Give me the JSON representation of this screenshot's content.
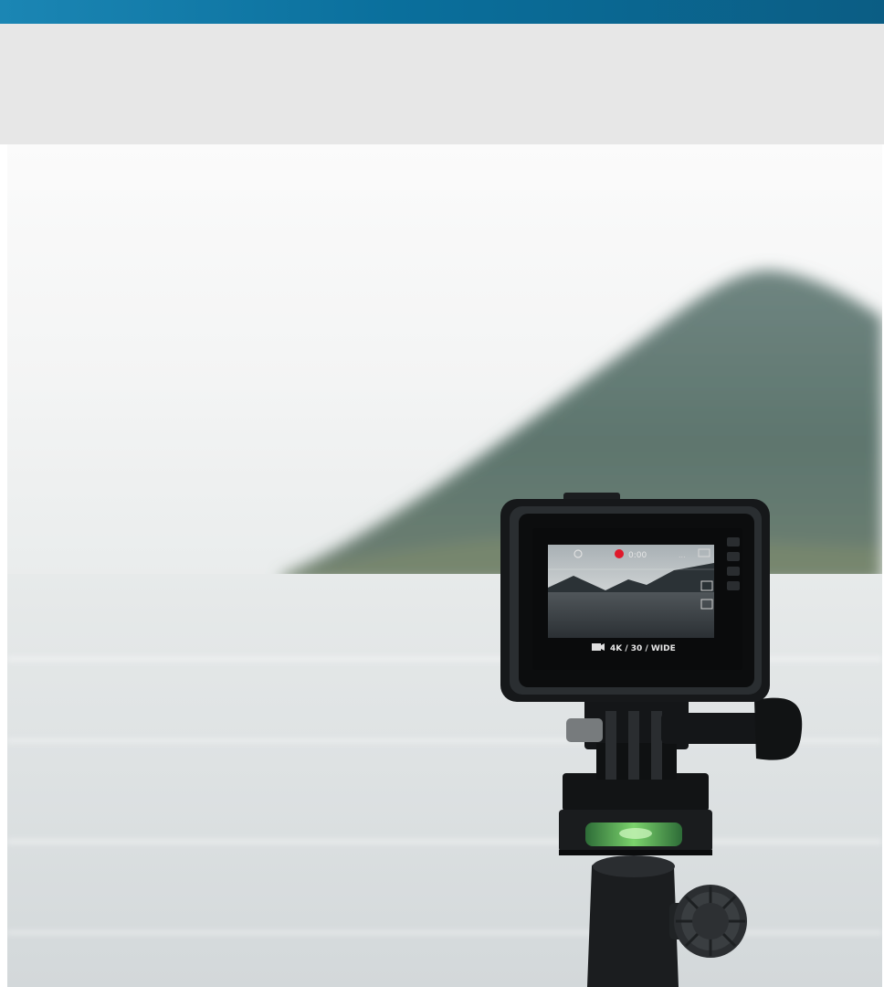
{
  "header": {},
  "photo": {
    "screen": {
      "timer": "0:00",
      "battery": "...",
      "mode_text": "4K / 30 / WIDE"
    }
  }
}
